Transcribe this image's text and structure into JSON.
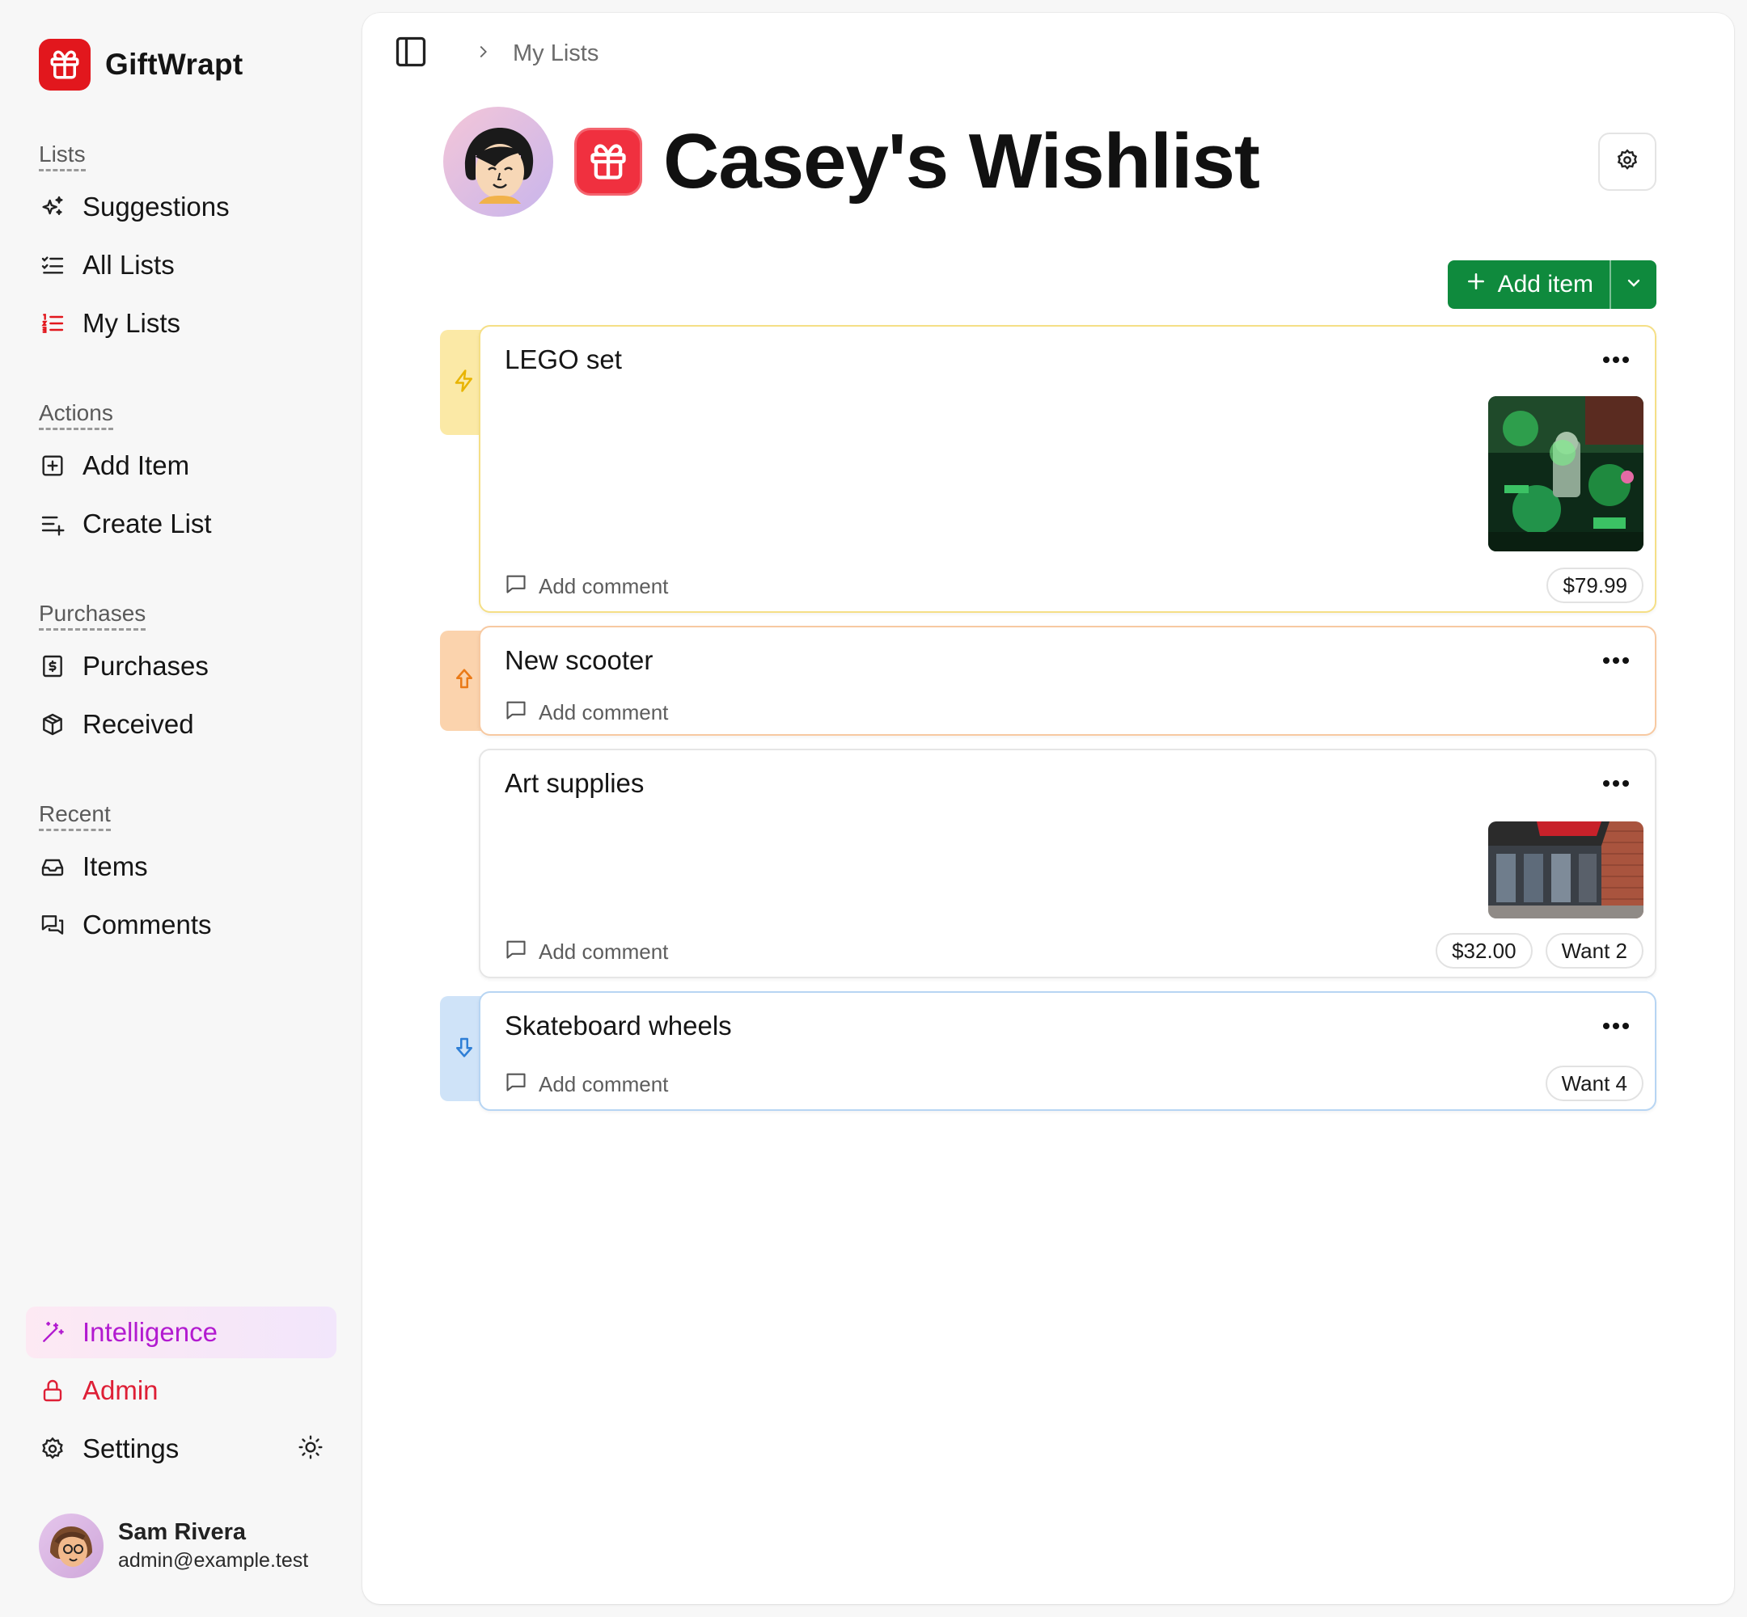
{
  "app": {
    "name": "GiftWrapt",
    "brand_color": "#e2171d"
  },
  "sidebar": {
    "sections": [
      {
        "label": "Lists",
        "items": [
          {
            "label": "Suggestions",
            "icon": "sparkles-icon"
          },
          {
            "label": "All Lists",
            "icon": "list-checks-icon"
          },
          {
            "label": "My Lists",
            "icon": "list-ordered-icon"
          }
        ]
      },
      {
        "label": "Actions",
        "items": [
          {
            "label": "Add Item",
            "icon": "square-plus-icon"
          },
          {
            "label": "Create List",
            "icon": "list-plus-icon"
          }
        ]
      },
      {
        "label": "Purchases",
        "items": [
          {
            "label": "Purchases",
            "icon": "receipt-icon"
          },
          {
            "label": "Received",
            "icon": "package-icon"
          }
        ]
      },
      {
        "label": "Recent",
        "items": [
          {
            "label": "Items",
            "icon": "inbox-icon"
          },
          {
            "label": "Comments",
            "icon": "messages-icon"
          }
        ]
      }
    ],
    "footer": {
      "intelligence": "Intelligence",
      "admin": "Admin",
      "settings": "Settings"
    },
    "user": {
      "name": "Sam Rivera",
      "email": "admin@example.test"
    }
  },
  "breadcrumb": {
    "current": "My Lists"
  },
  "list": {
    "title": "Casey's Wishlist",
    "add_item_label": "Add item",
    "items": [
      {
        "name": "LEGO set",
        "priority": "very-high",
        "priority_icon": "zap-icon",
        "comment_label": "Add comment",
        "chips": [
          "$79.99"
        ],
        "image": "lego-set-photo"
      },
      {
        "name": "New scooter",
        "priority": "high",
        "priority_icon": "arrow-up-icon",
        "comment_label": "Add comment",
        "chips": []
      },
      {
        "name": "Art supplies",
        "priority": "normal",
        "comment_label": "Add comment",
        "chips": [
          "$32.00",
          "Want 2"
        ],
        "image": "art-store-photo"
      },
      {
        "name": "Skateboard wheels",
        "priority": "low",
        "priority_icon": "arrow-down-icon",
        "comment_label": "Add comment",
        "chips": [
          "Want 4"
        ]
      }
    ]
  },
  "colors": {
    "accent_green": "#0f8a3d",
    "priority_very_high": "#f5d96a",
    "priority_high": "#f6b57a",
    "priority_low": "#aed0f3",
    "intelligence": "#b21ad0",
    "admin": "#de1f36"
  }
}
